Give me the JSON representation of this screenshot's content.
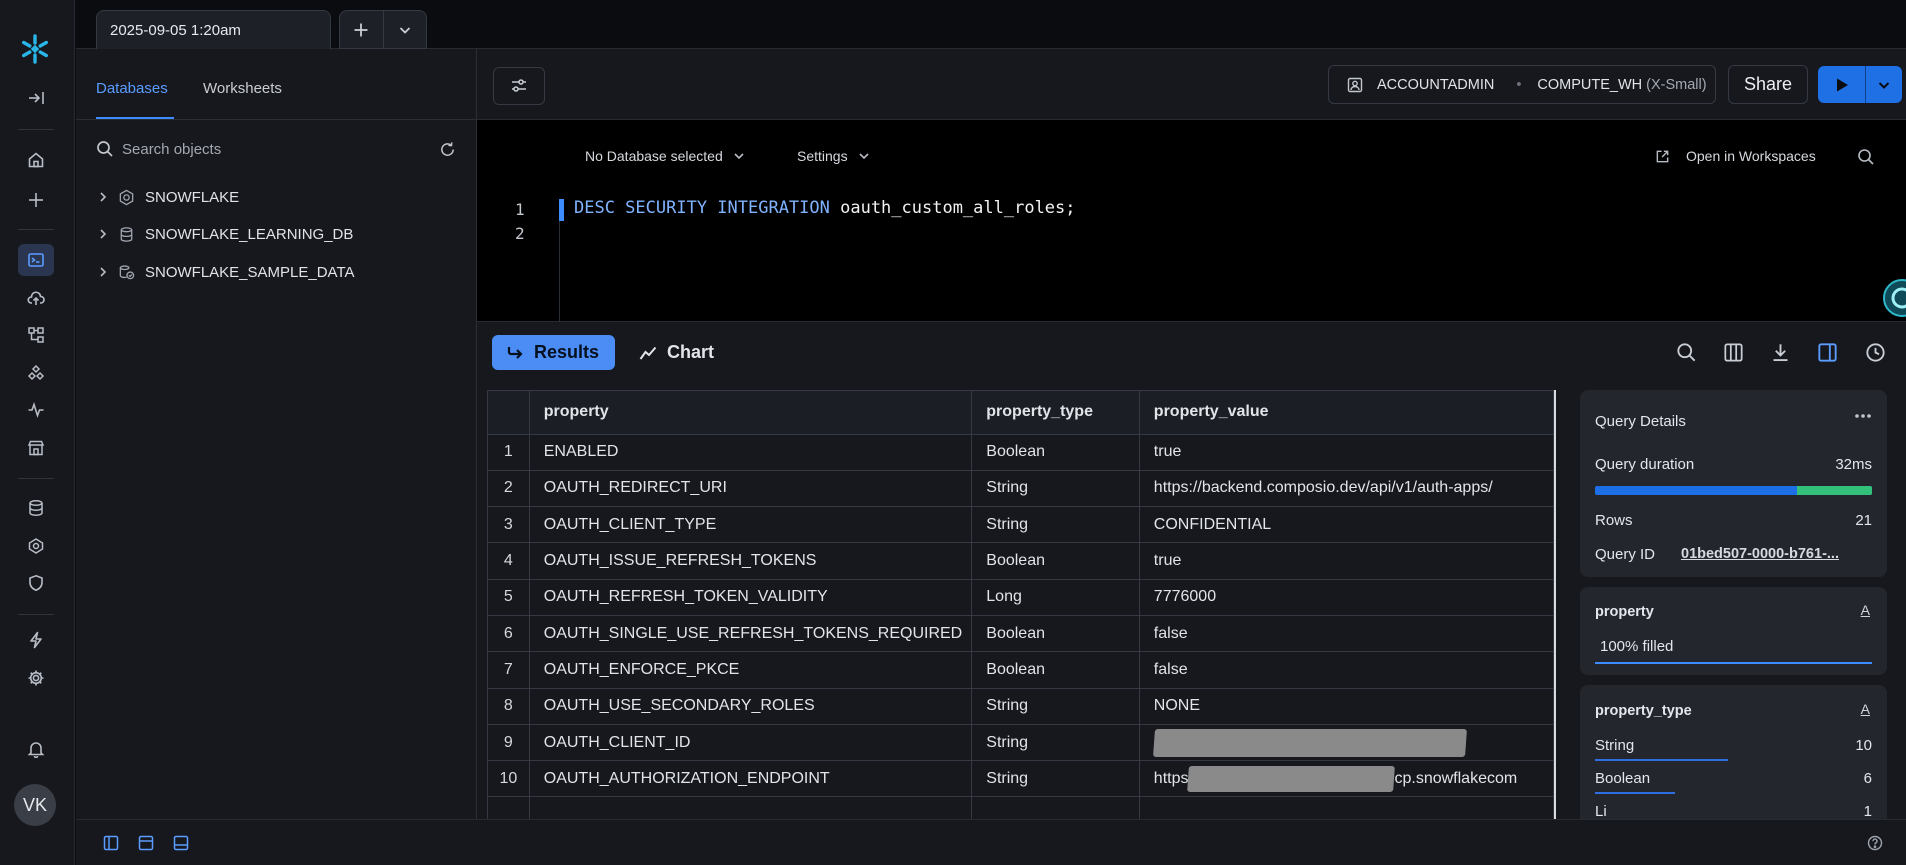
{
  "rail": {
    "user_initials": "VK"
  },
  "tabs": {
    "active_tab_label": "2025-09-05 1:20am"
  },
  "object_browser": {
    "tab_databases": "Databases",
    "tab_worksheets": "Worksheets",
    "search_placeholder": "Search objects",
    "items": [
      {
        "label": "SNOWFLAKE",
        "icon": "shared-database-icon"
      },
      {
        "label": "SNOWFLAKE_LEARNING_DB",
        "icon": "database-icon"
      },
      {
        "label": "SNOWFLAKE_SAMPLE_DATA",
        "icon": "shared-data-icon"
      }
    ]
  },
  "toolbar": {
    "role": "ACCOUNTADMIN",
    "warehouse": "COMPUTE_WH",
    "warehouse_size": "(X-Small)",
    "share_label": "Share"
  },
  "editor": {
    "database_select": "No Database selected",
    "settings_label": "Settings",
    "open_workspaces_label": "Open in Workspaces",
    "line_numbers": [
      "1",
      "2"
    ],
    "code_keywords": "DESC SECURITY INTEGRATION",
    "code_rest": " oauth_custom_all_roles;"
  },
  "results": {
    "results_label": "Results",
    "chart_label": "Chart",
    "columns": [
      "property",
      "property_type",
      "property_value"
    ],
    "rows": [
      {
        "n": "1",
        "property": "ENABLED",
        "type": "Boolean",
        "value": "true"
      },
      {
        "n": "2",
        "property": "OAUTH_REDIRECT_URI",
        "type": "String",
        "value": "https://backend.composio.dev/api/v1/auth-apps/"
      },
      {
        "n": "3",
        "property": "OAUTH_CLIENT_TYPE",
        "type": "String",
        "value": "CONFIDENTIAL"
      },
      {
        "n": "4",
        "property": "OAUTH_ISSUE_REFRESH_TOKENS",
        "type": "Boolean",
        "value": "true"
      },
      {
        "n": "5",
        "property": "OAUTH_REFRESH_TOKEN_VALIDITY",
        "type": "Long",
        "value": "7776000"
      },
      {
        "n": "6",
        "property": "OAUTH_SINGLE_USE_REFRESH_TOKENS_REQUIRED",
        "type": "Boolean",
        "value": "false"
      },
      {
        "n": "7",
        "property": "OAUTH_ENFORCE_PKCE",
        "type": "Boolean",
        "value": "false"
      },
      {
        "n": "8",
        "property": "OAUTH_USE_SECONDARY_ROLES",
        "type": "String",
        "value": "NONE"
      },
      {
        "n": "9",
        "property": "OAUTH_CLIENT_ID",
        "type": "String",
        "value": ""
      },
      {
        "n": "10",
        "property": "OAUTH_AUTHORIZATION_ENDPOINT",
        "type": "String",
        "value_prefix": "https",
        "value_suffix": "cp.snowflakecom"
      }
    ]
  },
  "query_details": {
    "title": "Query Details",
    "duration_label": "Query duration",
    "duration_value": "32ms",
    "rows_label": "Rows",
    "rows_value": "21",
    "query_id_label": "Query ID",
    "query_id_value": "01bed507-0000-b761-...",
    "duration_bar_green_fraction": 0.27
  },
  "column_stats": {
    "property": {
      "title": "property",
      "type_glyph": "A",
      "filled": "100% filled"
    },
    "property_type": {
      "title": "property_type",
      "type_glyph": "A",
      "values": [
        {
          "label": "String",
          "count": "10",
          "fraction": 0.48
        },
        {
          "label": "Boolean",
          "count": "6",
          "fraction": 0.29
        },
        {
          "label": "Li",
          "count": "1",
          "fraction": 0.05
        }
      ]
    }
  },
  "colors": {
    "accent": "#3d8bff",
    "run_button": "#1f6fe5",
    "duration_green": "#33c07a"
  }
}
